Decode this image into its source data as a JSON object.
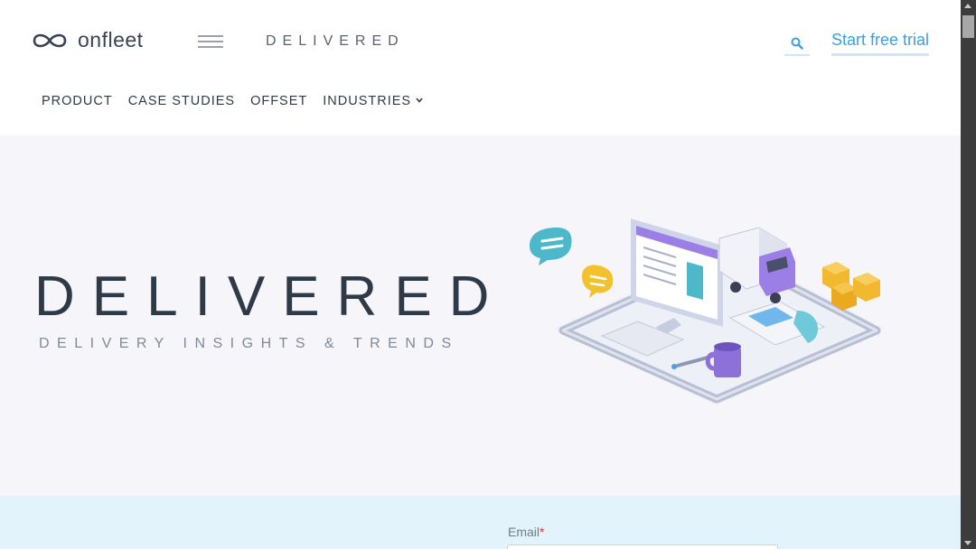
{
  "header": {
    "logo_text": "onfleet",
    "brand_mark": "DELIVERED",
    "trial_label": "Start free trial",
    "search_icon": "search-icon",
    "menu_icon": "hamburger-menu-icon"
  },
  "nav": {
    "items": [
      "PRODUCT",
      "CASE STUDIES",
      "OFFSET",
      "INDUSTRIES"
    ],
    "industries_caret": "chevron-down-icon"
  },
  "hero": {
    "title": "DELIVERED",
    "subtitle": "DELIVERY INSIGHTS & TRENDS"
  },
  "form": {
    "email_label": "Email",
    "required_mark": "*"
  },
  "colors": {
    "accent": "#3b9fe2",
    "text_dark": "#2f3a48",
    "hero_bg": "#f5f5fa",
    "form_bg": "#e3f3fc",
    "illustration_purple": "#9b7fe6",
    "illustration_teal": "#4cb8c9",
    "illustration_orange": "#f2b830"
  }
}
